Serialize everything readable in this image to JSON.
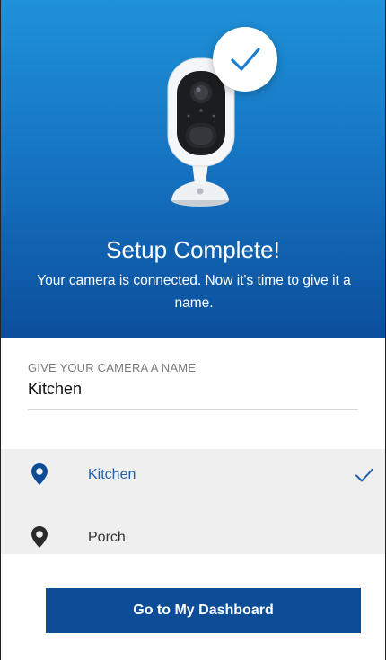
{
  "colors": {
    "hero_top": "#1f91d8",
    "hero_bottom": "#0c4f9c",
    "accent": "#0d4c97",
    "selected_text": "#1f5ea8",
    "list_bg": "#efefef"
  },
  "hero": {
    "illustration_icon": "security-camera",
    "badge_icon": "check-icon",
    "title": "Setup Complete!",
    "subtitle": "Your camera is connected. Now it's time to give it a name."
  },
  "name_form": {
    "label": "GIVE YOUR CAMERA A NAME",
    "value": "Kitchen"
  },
  "locations": {
    "items": [
      {
        "label": "Kitchen",
        "selected": true,
        "icon": "location-pin-icon"
      },
      {
        "label": "Porch",
        "selected": false,
        "icon": "location-pin-icon"
      }
    ]
  },
  "actions": {
    "dashboard_label": "Go to My Dashboard"
  }
}
